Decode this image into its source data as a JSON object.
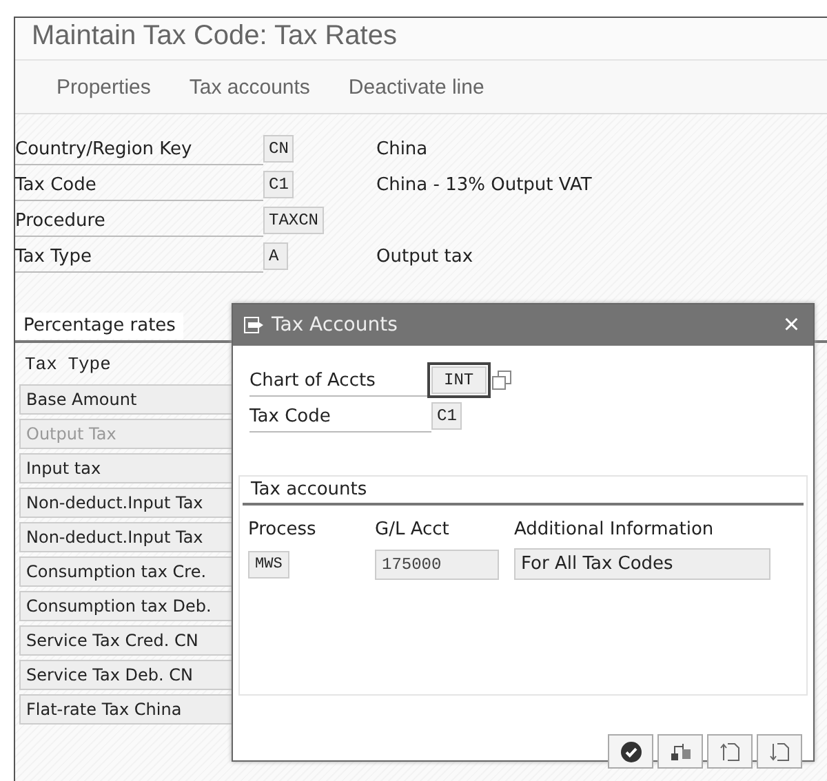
{
  "window": {
    "title": "Maintain Tax Code: Tax Rates"
  },
  "toolbar": [
    "Properties",
    "Tax accounts",
    "Deactivate line"
  ],
  "form": [
    {
      "label": "Country/Region Key",
      "value": "CN",
      "description": "China"
    },
    {
      "label": "Tax Code",
      "value": "C1",
      "description": "China - 13% Output VAT"
    },
    {
      "label": "Procedure",
      "value": "TAXCN"
    },
    {
      "label": "Tax Type",
      "value": "A",
      "description": "Output tax"
    }
  ],
  "percentage_rates": {
    "title": "Percentage rates",
    "column": "Tax Type",
    "items": [
      {
        "label": "Base Amount",
        "disabled": false
      },
      {
        "label": "Output Tax",
        "disabled": true
      },
      {
        "label": "Input tax",
        "disabled": false
      },
      {
        "label": "Non-deduct.Input Tax",
        "disabled": false
      },
      {
        "label": "Non-deduct.Input Tax",
        "disabled": false
      },
      {
        "label": "Consumption tax Cre.",
        "disabled": false
      },
      {
        "label": "Consumption tax Deb.",
        "disabled": false
      },
      {
        "label": "Service Tax Cred. CN",
        "disabled": false
      },
      {
        "label": "Service Tax Deb. CN",
        "disabled": false
      },
      {
        "label": "Flat-rate Tax China",
        "disabled": false
      }
    ]
  },
  "dialog": {
    "title": "Tax Accounts",
    "close": "×",
    "fields": [
      {
        "label": "Chart of Accts",
        "value": "INT",
        "focused": true
      },
      {
        "label": "Tax Code",
        "value": "C1",
        "focused": false
      }
    ],
    "group": {
      "title": "Tax accounts",
      "columns": [
        "Process",
        "G/L Acct",
        "Additional Information"
      ],
      "rows": [
        [
          "MWS",
          "175000",
          "For All Tax Codes"
        ]
      ]
    }
  }
}
